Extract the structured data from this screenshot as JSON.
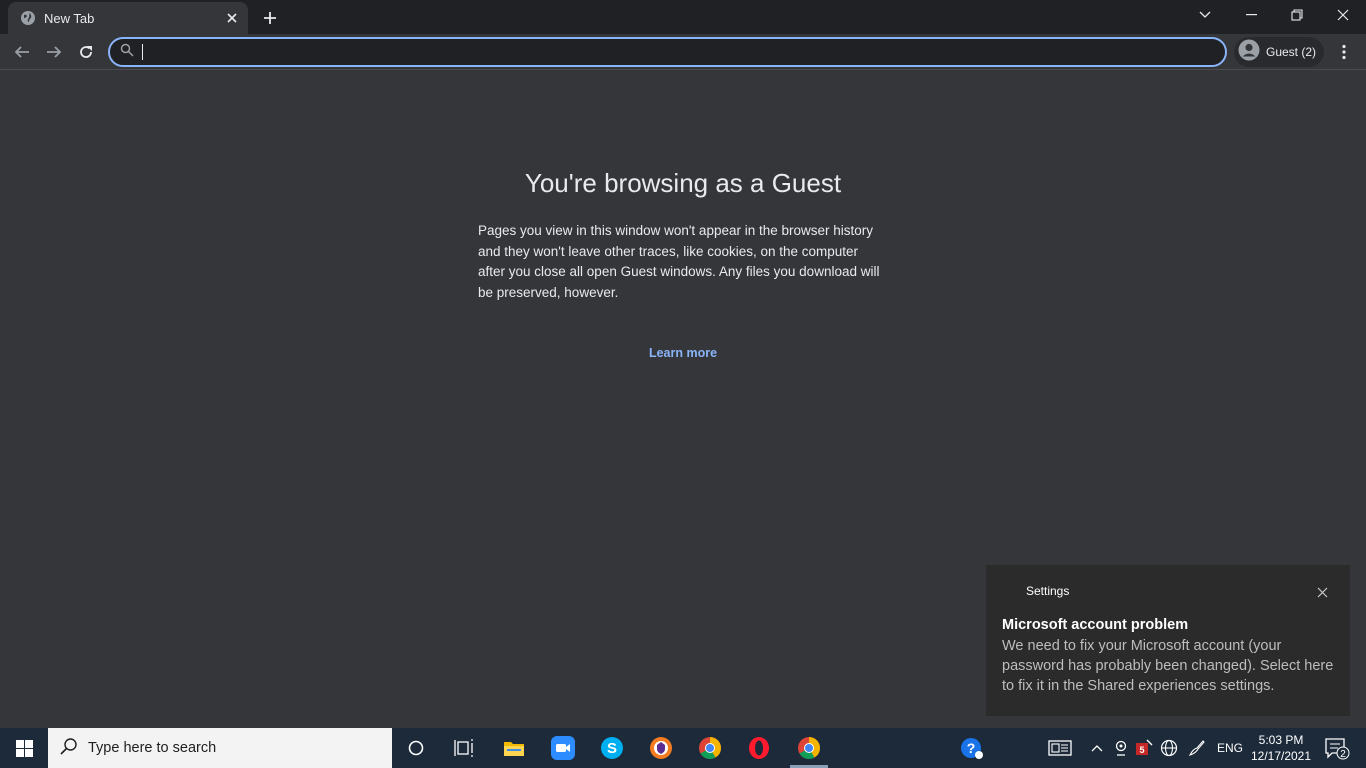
{
  "tab": {
    "title": "New Tab"
  },
  "omnibox": {
    "value": "",
    "placeholder": ""
  },
  "profile": {
    "label": "Guest (2)"
  },
  "guest_page": {
    "title": "You're browsing as a Guest",
    "description": "Pages you view in this window won't appear in the browser history and they won't leave other traces, like cookies, on the computer after you close all open Guest windows. Any files you download will be preserved, however.",
    "learn_more": "Learn more"
  },
  "toast": {
    "app": "Settings",
    "title": "Microsoft account problem",
    "body": "We need to fix your Microsoft account (your password has probably been changed). Select here to fix it in the Shared experiences settings."
  },
  "taskbar": {
    "search_placeholder": "Type here to search",
    "language": "ENG",
    "time": "5:03 PM",
    "date": "12/17/2021",
    "notification_count": "2",
    "pinned_apps": [
      "cortana-icon",
      "task-view-icon",
      "file-explorer-icon",
      "zoom-icon",
      "skype-icon",
      "avast-browser-icon",
      "chrome-icon",
      "opera-icon",
      "chrome-active-icon"
    ]
  },
  "colors": {
    "accent": "#8ab4f8",
    "page_bg": "#35363a",
    "tabstrip_bg": "#202124",
    "taskbar_bg": "#1c2a3a"
  }
}
